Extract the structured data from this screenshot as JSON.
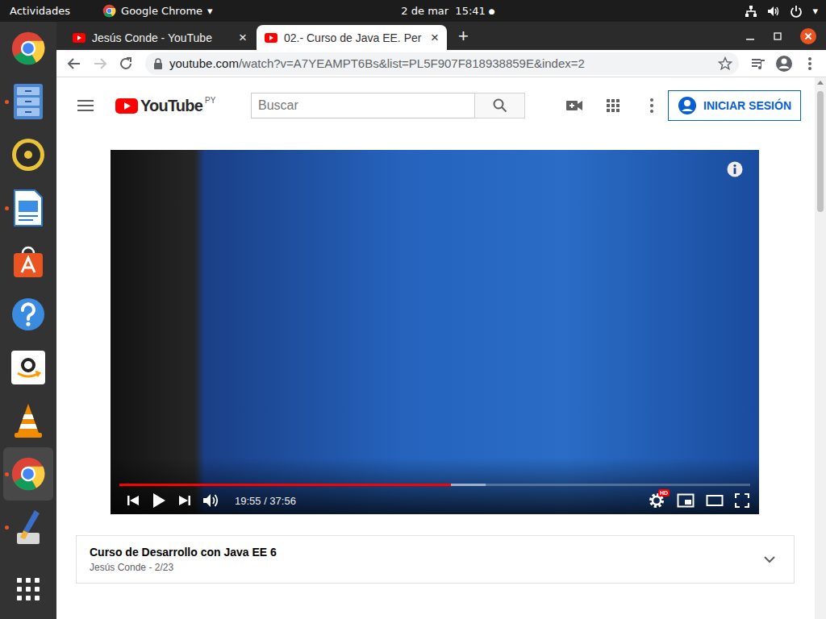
{
  "topbar": {
    "activities": "Actividades",
    "app": "Google Chrome",
    "app_arrow": "▾",
    "clock": "2 de mar  15:41",
    "record_dot": "●",
    "system_arrow": "▾"
  },
  "dock": {
    "items": [
      {
        "kind": "chrome",
        "running": false,
        "selected": false
      },
      {
        "kind": "files",
        "running": true,
        "selected": false
      },
      {
        "kind": "rhythmbox",
        "running": false,
        "selected": false
      },
      {
        "kind": "writer",
        "running": true,
        "selected": false
      },
      {
        "kind": "software",
        "running": false,
        "selected": false
      },
      {
        "kind": "help",
        "running": false,
        "selected": false
      },
      {
        "kind": "amazon",
        "running": false,
        "selected": false
      },
      {
        "kind": "vlc",
        "running": false,
        "selected": false
      },
      {
        "kind": "chrome",
        "running": true,
        "selected": true
      },
      {
        "kind": "paint",
        "running": true,
        "selected": false
      }
    ]
  },
  "browser": {
    "tabs": [
      {
        "label": "Jesús Conde - YouTube",
        "close": "×",
        "selected": false
      },
      {
        "label": "02.- Curso de Java EE. Per",
        "close": "×",
        "selected": true
      }
    ],
    "new_tab": "+",
    "forward_enabled": false,
    "bookmarked": false,
    "address": {
      "host": "youtube.com",
      "path": "/watch?v=A7YEAMPT6Bs&list=PL5F907F818938859E&index=2"
    }
  },
  "youtube": {
    "logo": "YouTube",
    "region": "PY",
    "search": {
      "placeholder": "Buscar"
    },
    "signin": "INICIAR SESIÓN"
  },
  "player": {
    "played": 0.525,
    "buffered": 0.58,
    "paused": true,
    "time": "19:55 / 37:56",
    "hd_badge": "HD"
  },
  "playlist": {
    "title": "Curso de Desarrollo con Java EE 6",
    "subtitle": "Jesús Conde - 2/23",
    "expanded": false
  }
}
